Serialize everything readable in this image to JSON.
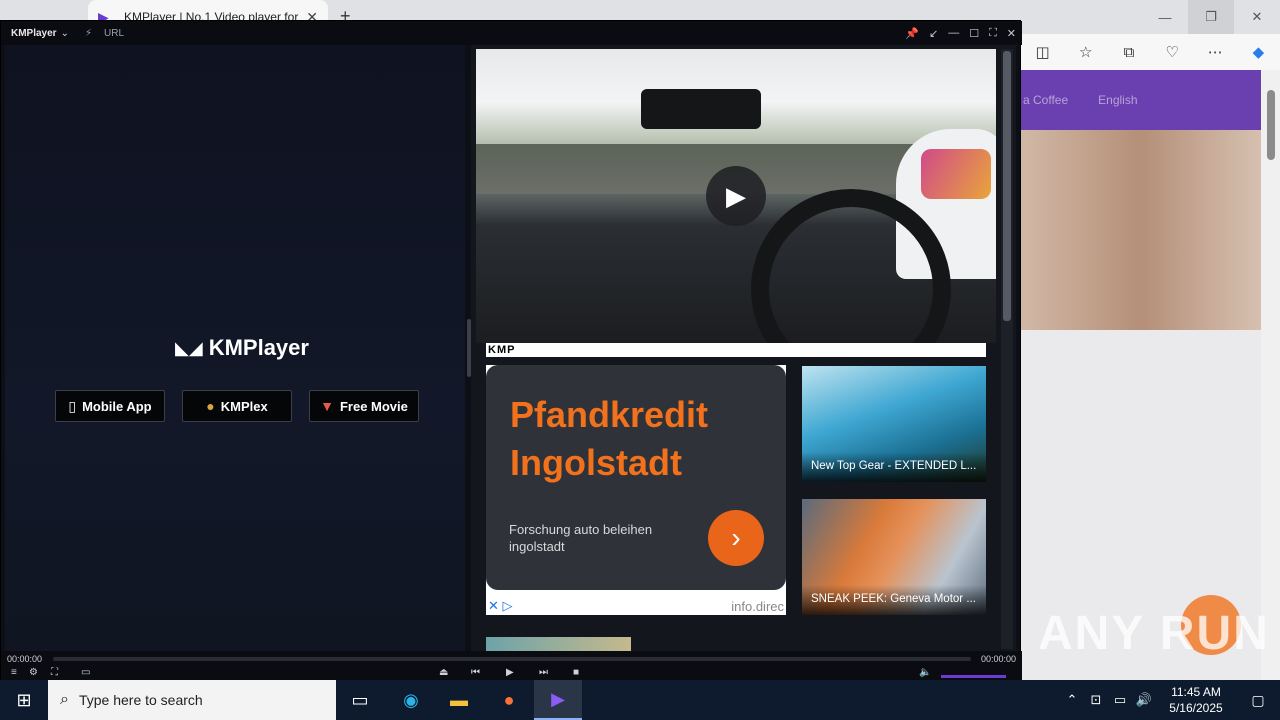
{
  "browser": {
    "tab_title": "KMPlayer | No.1 Video player for",
    "new_tab": "+",
    "banner_items": [
      "a Coffee",
      "English"
    ],
    "watermark": "ANY RUN"
  },
  "kmplayer": {
    "brand_small": "KMPlayer",
    "url_label": "URL",
    "brand_big": "KMPlayer",
    "buttons": {
      "mobile_app": "Mobile App",
      "kmplex": "KMPlex",
      "free_movie": "Free Movie"
    },
    "strip_logo": "KMP",
    "ad": {
      "title_line1": "Pfandkredit",
      "title_line2": "Ingolstadt",
      "subtitle": "Forschung auto beleihen ingolstadt",
      "domain": "info.direc"
    },
    "thumbs": [
      {
        "caption": "New Top Gear - EXTENDED L..."
      },
      {
        "caption": "SNEAK PEEK: Geneva Motor ..."
      }
    ],
    "time_left": "00:00:00",
    "time_right": "00:00:00"
  },
  "taskbar": {
    "search_placeholder": "Type here to search",
    "time": "11:45 AM",
    "date": "5/16/2025"
  },
  "colors": {
    "accent_orange": "#f2711c",
    "kmp_purple": "#6d3ad8",
    "taskbar_bg": "#0e1b2e"
  }
}
